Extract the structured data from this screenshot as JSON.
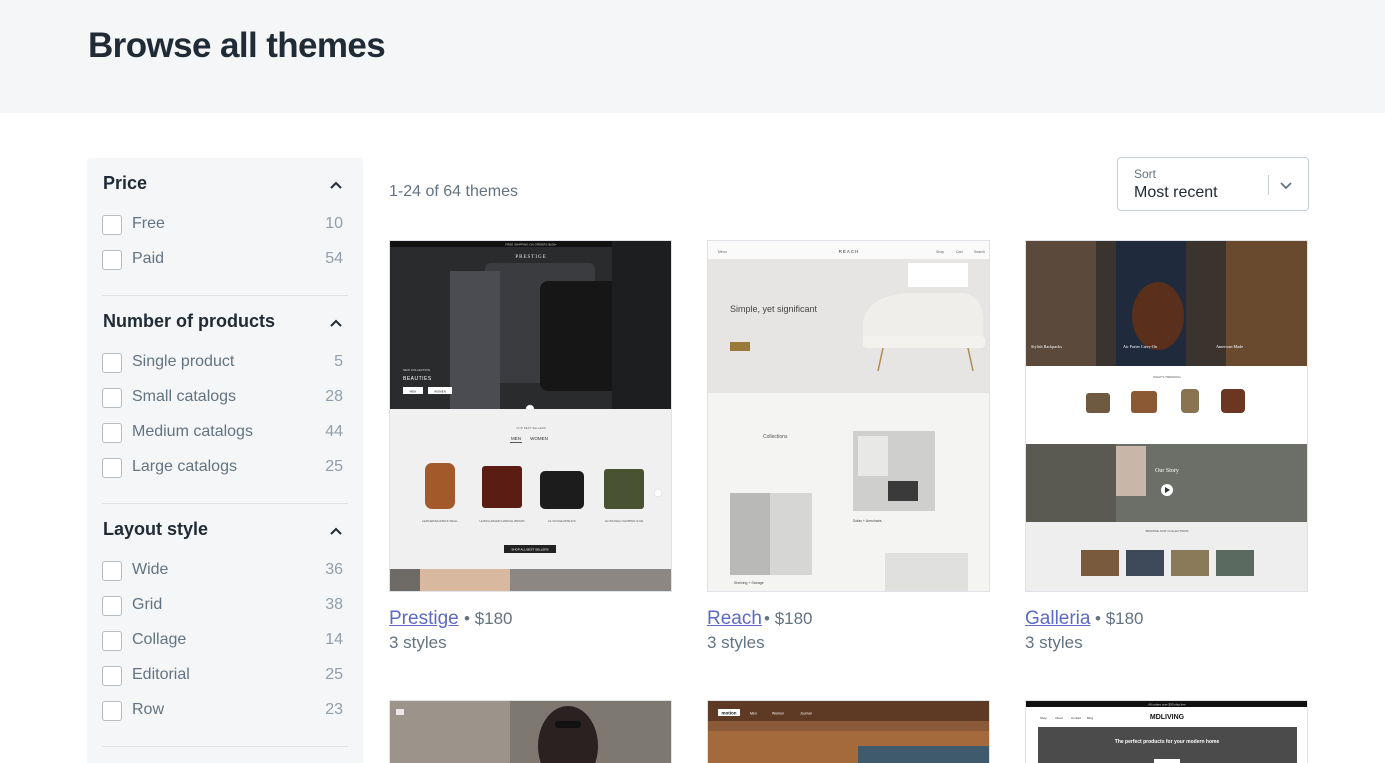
{
  "page": {
    "title": "Browse all themes"
  },
  "filters": {
    "price": {
      "title": "Price",
      "options": [
        {
          "label": "Free",
          "count": "10"
        },
        {
          "label": "Paid",
          "count": "54"
        }
      ]
    },
    "products": {
      "title": "Number of products",
      "options": [
        {
          "label": "Single product",
          "count": "5"
        },
        {
          "label": "Small catalogs",
          "count": "28"
        },
        {
          "label": "Medium catalogs",
          "count": "44"
        },
        {
          "label": "Large catalogs",
          "count": "25"
        }
      ]
    },
    "layout": {
      "title": "Layout style",
      "options": [
        {
          "label": "Wide",
          "count": "36"
        },
        {
          "label": "Grid",
          "count": "38"
        },
        {
          "label": "Collage",
          "count": "14"
        },
        {
          "label": "Editorial",
          "count": "25"
        },
        {
          "label": "Row",
          "count": "23"
        }
      ]
    }
  },
  "results": {
    "count_text": "1-24 of 64 themes"
  },
  "sort": {
    "label": "Sort",
    "value": "Most recent"
  },
  "themes": [
    {
      "name": "Prestige",
      "price": "$180",
      "styles": "3 styles",
      "preview": {
        "promo": "FREE SHIPPING ON ORDERS $100+",
        "brand": "PRESTIGE",
        "collection": "NEW COLLECTION",
        "hero": "BEAUTIES",
        "buttons": [
          "MEN",
          "WOMEN"
        ],
        "section": "OUR BEST SELLERS",
        "tabs": [
          "MEN",
          "WOMEN"
        ],
        "products": [
          "LEATHER BACKPACK SMALL",
          "LE BOULANGER CARRYALL BROWN",
          "LE VOYAGEUR BLACK",
          "LE NOUVEAU SHOPPER OLIVE"
        ],
        "cta": "SHOP ALL BEST SELLERS"
      }
    },
    {
      "name": "Reach",
      "price": "$180",
      "styles": "3 styles",
      "preview": {
        "brand": "REACH",
        "menu": "Menu",
        "nav": [
          "Shop",
          "Cart",
          "Search"
        ],
        "headline": "Simple, yet significant",
        "collections": "Collections",
        "captions": [
          "Sofas + Armchairs",
          "Shelving + Storage"
        ]
      }
    },
    {
      "name": "Galleria",
      "price": "$180",
      "styles": "3 styles",
      "preview": {
        "features": [
          "Stylish Backpacks",
          "Air Porter Carry-On",
          "American Made"
        ],
        "trending": "WHAT'S TRENDING",
        "story": "Our Story",
        "collections": "BROWSE OUR COLLECTIONS"
      }
    },
    {
      "name": "",
      "price": "",
      "styles": "",
      "preview": {}
    },
    {
      "name": "",
      "price": "",
      "styles": "",
      "preview": {
        "brand": "motion",
        "nav": [
          "Men",
          "Women",
          "Journal"
        ]
      }
    },
    {
      "name": "",
      "price": "",
      "styles": "",
      "preview": {
        "promo": "All orders over $50 ship free",
        "brand": "MDLIVING",
        "nav": [
          "Shop",
          "About",
          "Contact",
          "Blog"
        ],
        "hero": "The perfect products for your modern home"
      }
    }
  ],
  "colors": {
    "accent": "#5c6ac4",
    "hero_bg": "#f4f6f8",
    "sidebar_bg": "#f4f6f8",
    "text": "#212b36",
    "muted": "#637381"
  },
  "icons": {
    "collapse": "chevron-up-icon",
    "dropdown": "chevron-down-icon"
  }
}
